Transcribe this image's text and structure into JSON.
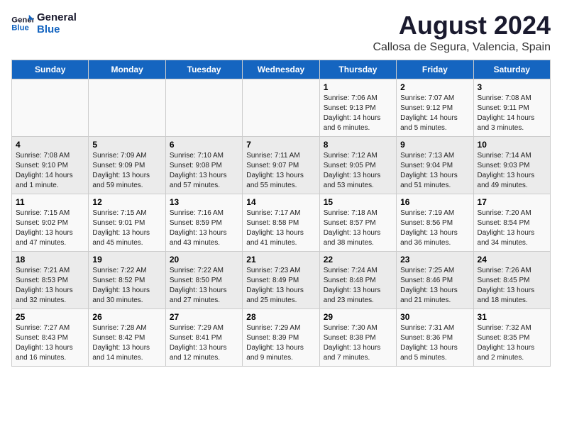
{
  "logo": {
    "line1": "General",
    "line2": "Blue"
  },
  "title": "August 2024",
  "location": "Callosa de Segura, Valencia, Spain",
  "weekdays": [
    "Sunday",
    "Monday",
    "Tuesday",
    "Wednesday",
    "Thursday",
    "Friday",
    "Saturday"
  ],
  "weeks": [
    [
      {
        "day": "",
        "info": ""
      },
      {
        "day": "",
        "info": ""
      },
      {
        "day": "",
        "info": ""
      },
      {
        "day": "",
        "info": ""
      },
      {
        "day": "1",
        "info": "Sunrise: 7:06 AM\nSunset: 9:13 PM\nDaylight: 14 hours\nand 6 minutes."
      },
      {
        "day": "2",
        "info": "Sunrise: 7:07 AM\nSunset: 9:12 PM\nDaylight: 14 hours\nand 5 minutes."
      },
      {
        "day": "3",
        "info": "Sunrise: 7:08 AM\nSunset: 9:11 PM\nDaylight: 14 hours\nand 3 minutes."
      }
    ],
    [
      {
        "day": "4",
        "info": "Sunrise: 7:08 AM\nSunset: 9:10 PM\nDaylight: 14 hours\nand 1 minute."
      },
      {
        "day": "5",
        "info": "Sunrise: 7:09 AM\nSunset: 9:09 PM\nDaylight: 13 hours\nand 59 minutes."
      },
      {
        "day": "6",
        "info": "Sunrise: 7:10 AM\nSunset: 9:08 PM\nDaylight: 13 hours\nand 57 minutes."
      },
      {
        "day": "7",
        "info": "Sunrise: 7:11 AM\nSunset: 9:07 PM\nDaylight: 13 hours\nand 55 minutes."
      },
      {
        "day": "8",
        "info": "Sunrise: 7:12 AM\nSunset: 9:05 PM\nDaylight: 13 hours\nand 53 minutes."
      },
      {
        "day": "9",
        "info": "Sunrise: 7:13 AM\nSunset: 9:04 PM\nDaylight: 13 hours\nand 51 minutes."
      },
      {
        "day": "10",
        "info": "Sunrise: 7:14 AM\nSunset: 9:03 PM\nDaylight: 13 hours\nand 49 minutes."
      }
    ],
    [
      {
        "day": "11",
        "info": "Sunrise: 7:15 AM\nSunset: 9:02 PM\nDaylight: 13 hours\nand 47 minutes."
      },
      {
        "day": "12",
        "info": "Sunrise: 7:15 AM\nSunset: 9:01 PM\nDaylight: 13 hours\nand 45 minutes."
      },
      {
        "day": "13",
        "info": "Sunrise: 7:16 AM\nSunset: 8:59 PM\nDaylight: 13 hours\nand 43 minutes."
      },
      {
        "day": "14",
        "info": "Sunrise: 7:17 AM\nSunset: 8:58 PM\nDaylight: 13 hours\nand 41 minutes."
      },
      {
        "day": "15",
        "info": "Sunrise: 7:18 AM\nSunset: 8:57 PM\nDaylight: 13 hours\nand 38 minutes."
      },
      {
        "day": "16",
        "info": "Sunrise: 7:19 AM\nSunset: 8:56 PM\nDaylight: 13 hours\nand 36 minutes."
      },
      {
        "day": "17",
        "info": "Sunrise: 7:20 AM\nSunset: 8:54 PM\nDaylight: 13 hours\nand 34 minutes."
      }
    ],
    [
      {
        "day": "18",
        "info": "Sunrise: 7:21 AM\nSunset: 8:53 PM\nDaylight: 13 hours\nand 32 minutes."
      },
      {
        "day": "19",
        "info": "Sunrise: 7:22 AM\nSunset: 8:52 PM\nDaylight: 13 hours\nand 30 minutes."
      },
      {
        "day": "20",
        "info": "Sunrise: 7:22 AM\nSunset: 8:50 PM\nDaylight: 13 hours\nand 27 minutes."
      },
      {
        "day": "21",
        "info": "Sunrise: 7:23 AM\nSunset: 8:49 PM\nDaylight: 13 hours\nand 25 minutes."
      },
      {
        "day": "22",
        "info": "Sunrise: 7:24 AM\nSunset: 8:48 PM\nDaylight: 13 hours\nand 23 minutes."
      },
      {
        "day": "23",
        "info": "Sunrise: 7:25 AM\nSunset: 8:46 PM\nDaylight: 13 hours\nand 21 minutes."
      },
      {
        "day": "24",
        "info": "Sunrise: 7:26 AM\nSunset: 8:45 PM\nDaylight: 13 hours\nand 18 minutes."
      }
    ],
    [
      {
        "day": "25",
        "info": "Sunrise: 7:27 AM\nSunset: 8:43 PM\nDaylight: 13 hours\nand 16 minutes."
      },
      {
        "day": "26",
        "info": "Sunrise: 7:28 AM\nSunset: 8:42 PM\nDaylight: 13 hours\nand 14 minutes."
      },
      {
        "day": "27",
        "info": "Sunrise: 7:29 AM\nSunset: 8:41 PM\nDaylight: 13 hours\nand 12 minutes."
      },
      {
        "day": "28",
        "info": "Sunrise: 7:29 AM\nSunset: 8:39 PM\nDaylight: 13 hours\nand 9 minutes."
      },
      {
        "day": "29",
        "info": "Sunrise: 7:30 AM\nSunset: 8:38 PM\nDaylight: 13 hours\nand 7 minutes."
      },
      {
        "day": "30",
        "info": "Sunrise: 7:31 AM\nSunset: 8:36 PM\nDaylight: 13 hours\nand 5 minutes."
      },
      {
        "day": "31",
        "info": "Sunrise: 7:32 AM\nSunset: 8:35 PM\nDaylight: 13 hours\nand 2 minutes."
      }
    ]
  ]
}
